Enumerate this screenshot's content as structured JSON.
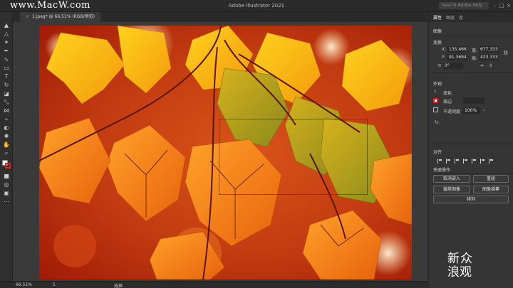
{
  "watermark": "www.MacW.com",
  "window": {
    "title": "Adobe Illustrator 2021",
    "search_placeholder": "Search Adobe Help"
  },
  "document_tab": {
    "close": "×",
    "label": "1.jpeg* @ 66.51% (RGB/预览)"
  },
  "status": {
    "zoom": "66.51%",
    "page": "1",
    "tool_label": "选择"
  },
  "panel": {
    "tabs": [
      "属性",
      "图层",
      "库"
    ],
    "selection_type": "图像",
    "transform": {
      "title": "变换",
      "x_label": "X:",
      "x_value": "135.466",
      "y_label": "Y:",
      "y_value": "91.3694",
      "w_label": "宽:",
      "w_value": "677.333",
      "h_label": "高:",
      "h_value": "423.333",
      "rotate_value": "0°"
    },
    "appearance": {
      "title": "外观",
      "fill_label": "填色",
      "stroke_label": "描边",
      "opacity_label": "不透明度",
      "opacity_value": "100%",
      "fx_label": "fx."
    },
    "align": {
      "title": "对齐"
    },
    "quick_actions": {
      "title": "快速操作",
      "buttons": [
        "取消嵌入",
        "重组",
        "裁剪图像",
        "图像描摹",
        "排列"
      ]
    }
  },
  "logo_text": {
    "line1": "新众",
    "line2": "浪观"
  },
  "colors": {
    "accent_stroke": "#e02020",
    "ui_background": "#323232"
  }
}
